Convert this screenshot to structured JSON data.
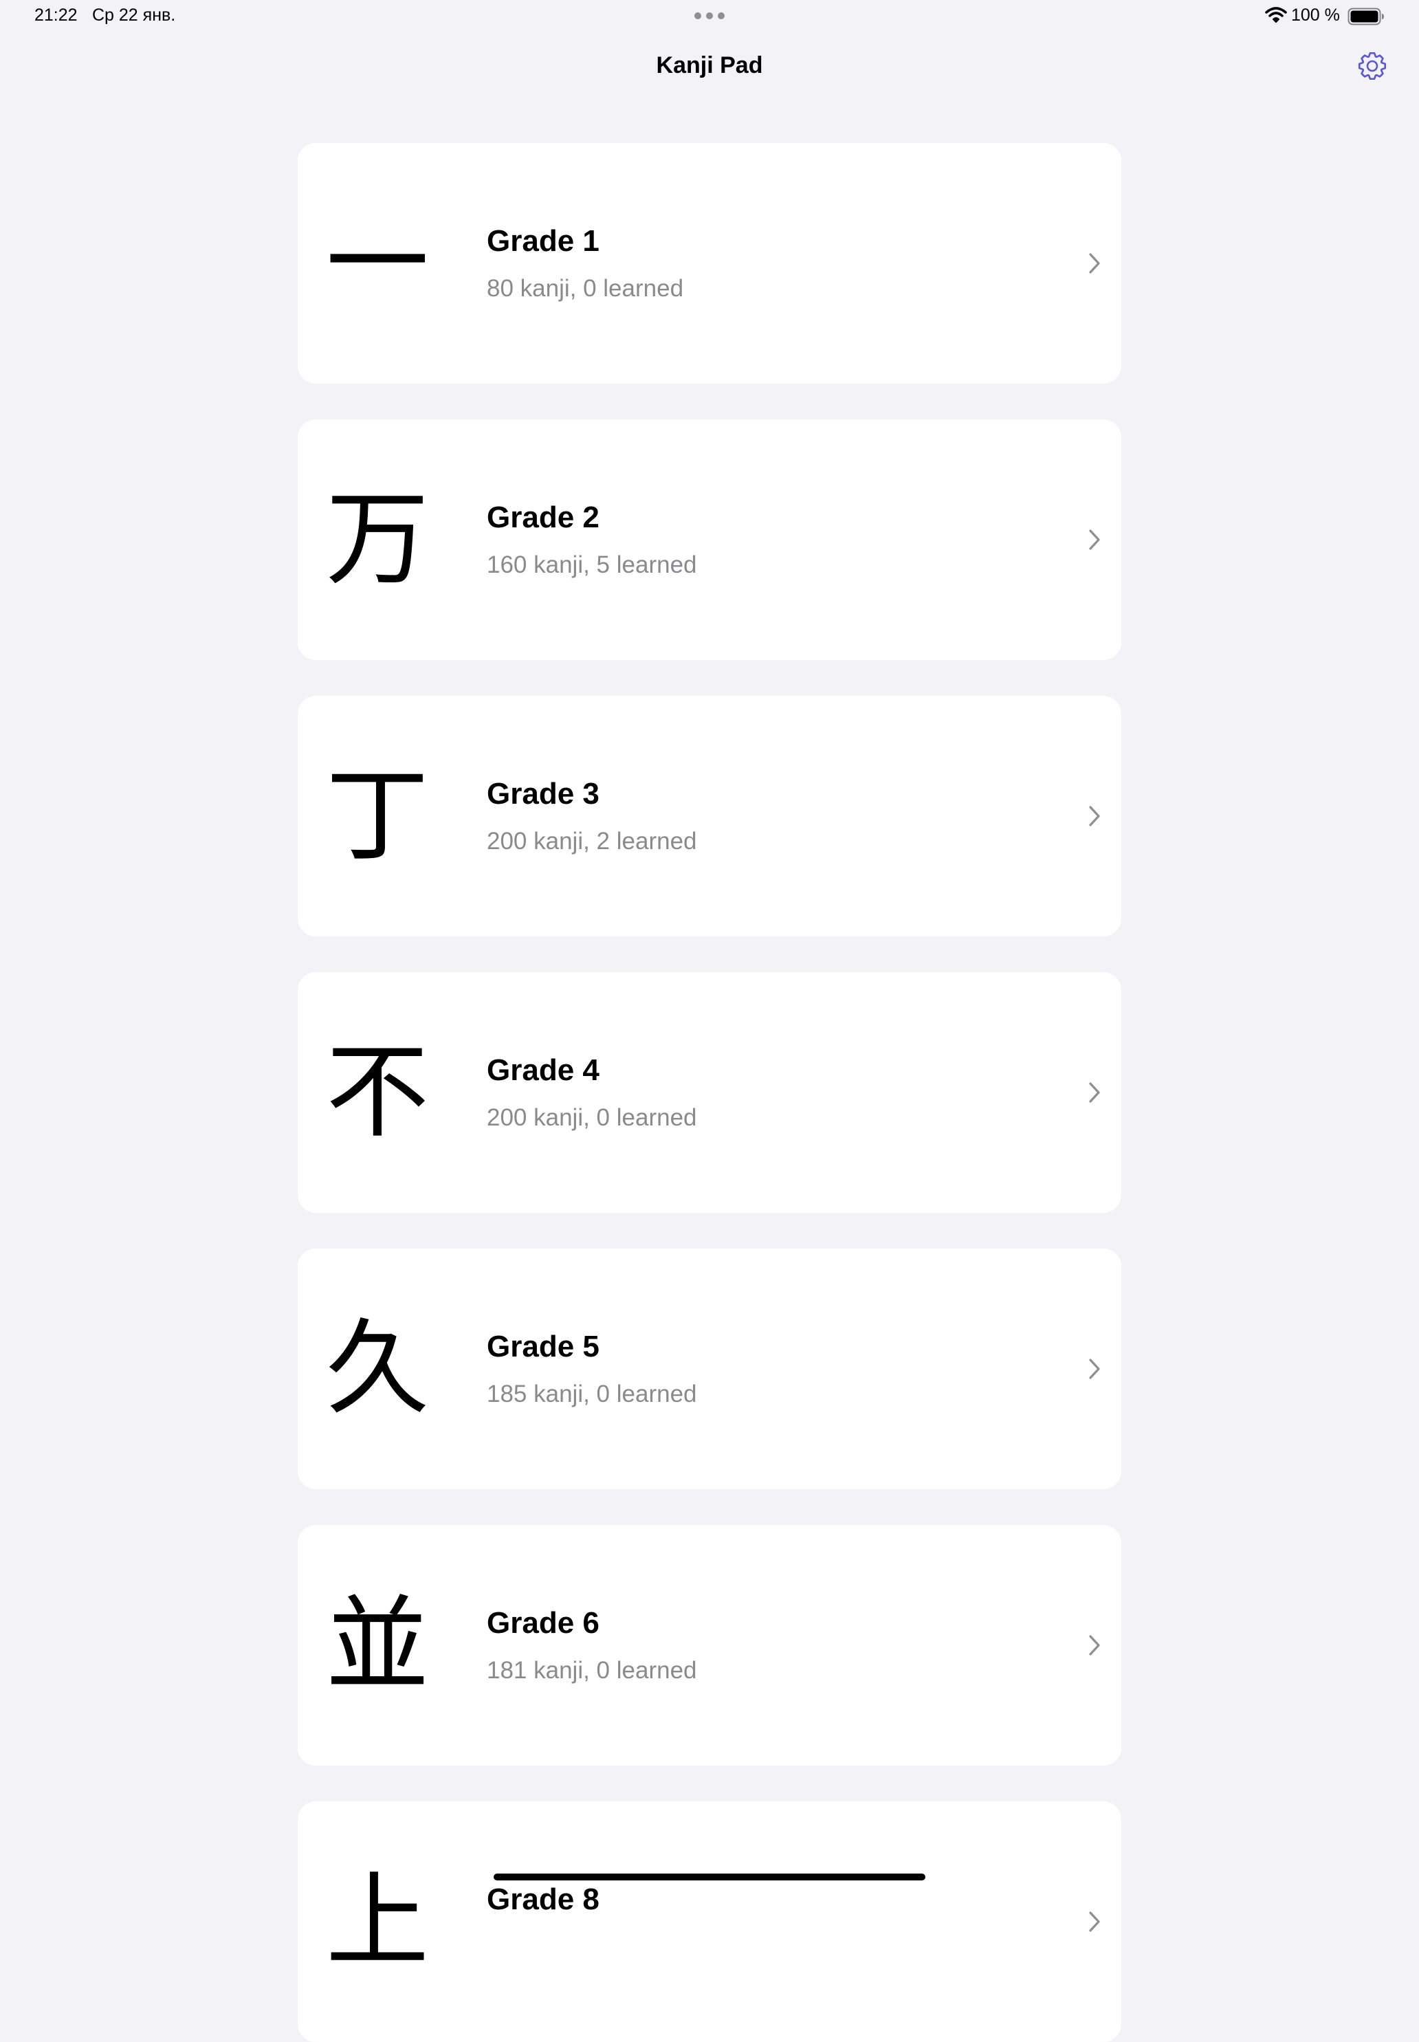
{
  "status_bar": {
    "time": "21:22",
    "date": "Ср 22 янв.",
    "battery_percent": "100 %",
    "icons": [
      "multitask-dots-icon",
      "wifi-icon",
      "battery-icon"
    ]
  },
  "navigation": {
    "title": "Kanji Pad",
    "settings_icon": "gear-icon",
    "accent_color": "#5856d6"
  },
  "grades": [
    {
      "kanji": "一",
      "title": "Grade 1",
      "subtitle": "80 kanji, 0 learned"
    },
    {
      "kanji": "万",
      "title": "Grade 2",
      "subtitle": "160 kanji, 5 learned"
    },
    {
      "kanji": "丁",
      "title": "Grade 3",
      "subtitle": "200 kanji, 2 learned"
    },
    {
      "kanji": "不",
      "title": "Grade 4",
      "subtitle": "200 kanji, 0 learned"
    },
    {
      "kanji": "久",
      "title": "Grade 5",
      "subtitle": "185 kanji, 0 learned"
    },
    {
      "kanji": "並",
      "title": "Grade 6",
      "subtitle": "181 kanji, 0 learned"
    },
    {
      "kanji": "上",
      "title": "Grade 8",
      "subtitle": ""
    }
  ],
  "colors": {
    "background": "#f2f2f7",
    "card": "#ffffff",
    "secondary_text": "#8a8a8e",
    "chevron": "#8e8e93"
  }
}
